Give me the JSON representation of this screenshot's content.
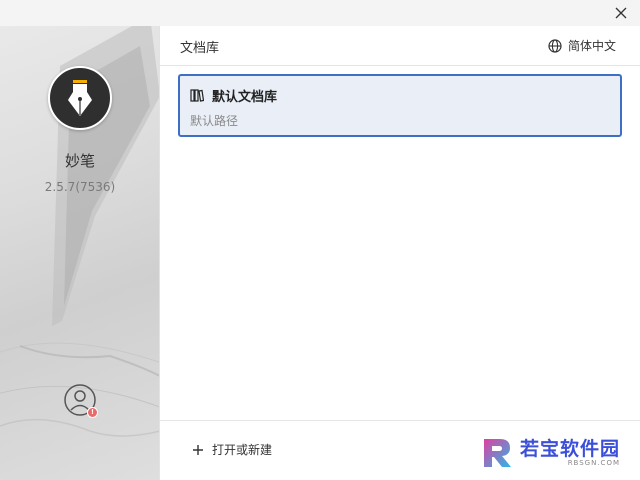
{
  "window": {
    "close_icon": "close-icon"
  },
  "sidebar": {
    "logo_icon": "fountain-pen-icon",
    "app_name": "妙笔",
    "version": "2.5.7(7536)",
    "avatar_icon": "user-circle-icon",
    "badge_text": "!"
  },
  "main": {
    "title": "文档库",
    "language": {
      "label": "简体中文",
      "icon": "globe-icon"
    },
    "libraries": [
      {
        "name": "默认文档库",
        "path": "默认路径",
        "icon": "library-books-icon",
        "selected": true
      }
    ],
    "footer": {
      "open_or_new_label": "打开或新建",
      "icon": "plus-icon"
    }
  },
  "watermark": {
    "text": "若宝软件园",
    "sub": "RBSGN.COM"
  },
  "colors": {
    "accent": "#3d6fc4",
    "selected_bg": "#e9eef7",
    "logo_bg": "#2f2f2f",
    "badge": "#e86a6a"
  }
}
